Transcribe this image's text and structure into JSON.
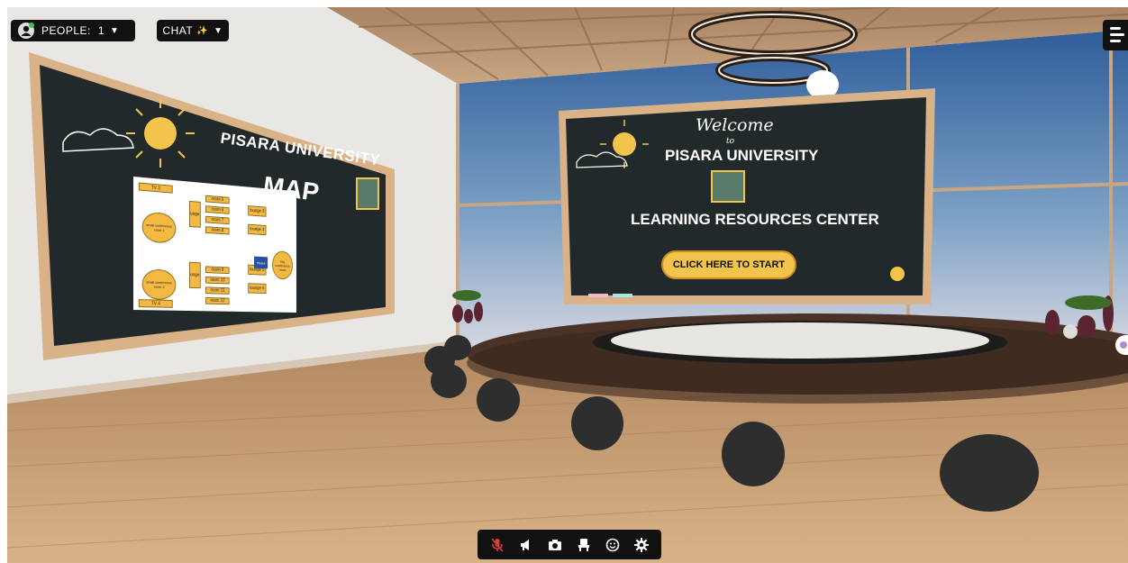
{
  "hud": {
    "people_label": "PEOPLE:",
    "people_count": "1",
    "chat_label": "CHAT",
    "chat_sparkle": "✨"
  },
  "map_board": {
    "title": "PISARA UNIVERSITY",
    "subtitle": "MAP",
    "rooms": [
      "TV 3",
      "TV 4",
      "lounge 1",
      "lounge 2",
      "lounge 3",
      "lounge 4",
      "lounge 5",
      "lounge 6",
      "room 5",
      "room 6",
      "room 7",
      "room 8",
      "room 9",
      "room 10",
      "room 11",
      "room 12"
    ],
    "ovals": [
      "small conference room 1",
      "small conference room 2",
      "big conference room"
    ],
    "marker": "Pisara",
    "info_label": "i"
  },
  "welcome_board": {
    "welcome": "Welcome",
    "to": "to",
    "title": "PISARA UNIVERSITY",
    "heading": "LEARNING RESOURCES CENTER",
    "button_label": "CLICK HERE TO START"
  },
  "toolbar": {
    "items": [
      "mic-muted-icon",
      "megaphone-icon",
      "camera-icon",
      "seat-icon",
      "emoji-icon",
      "settings-icon"
    ]
  },
  "colors": {
    "board": "#22292a",
    "accent": "#f3c44b",
    "floor": "#c99e72",
    "muted_red": "#e0393b"
  }
}
